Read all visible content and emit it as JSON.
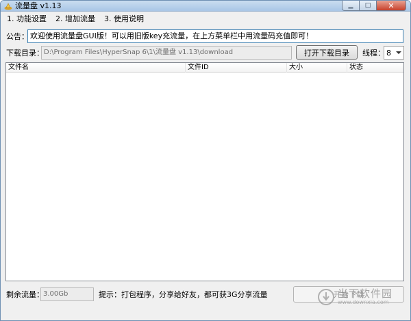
{
  "window": {
    "title": "流量盘 v1.13",
    "controls": {
      "minimize": "▁",
      "maximize": "□",
      "close": "✕"
    }
  },
  "menu": {
    "items": [
      {
        "label": "1. 功能设置"
      },
      {
        "label": "2. 增加流量"
      },
      {
        "label": "3. 使用说明"
      }
    ]
  },
  "notice": {
    "label": "公告：",
    "value": "欢迎使用流量盘GUI版！可以用旧版key充流量，在上方菜单栏中用流量码充值即可！"
  },
  "download": {
    "label": "下载目录：",
    "path": "D:\\Program Files\\HyperSnap 6\\1\\流量盘 v1.13\\download",
    "open_button": "打开下载目录",
    "threads_label": "线程：",
    "threads_value": "8"
  },
  "file_list": {
    "columns": [
      "文件名",
      "文件ID",
      "大小",
      "状态"
    ],
    "rows": []
  },
  "footer": {
    "remaining_label": "剩余流量：",
    "remaining_value": "3.00Gb",
    "hint": "提示：打包程序，分享给好友，都可获3G分享流量",
    "start_button": "开始下载"
  },
  "watermark": {
    "main": "当下软件园",
    "sub": "www.downxia.com"
  }
}
